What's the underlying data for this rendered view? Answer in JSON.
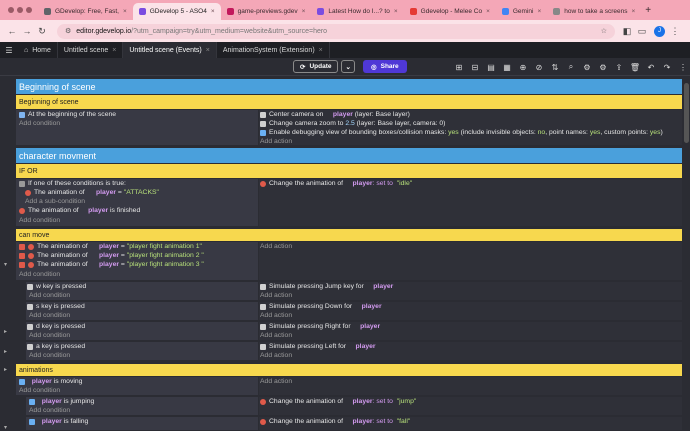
{
  "browser": {
    "tabs": [
      {
        "label": "GDevelop: Free, Fast,",
        "color": "#5f6368",
        "active": false
      },
      {
        "label": "GDevelop 5 - ASO4",
        "color": "#7b4ce0",
        "active": true
      },
      {
        "label": "game-previews.gdev",
        "color": "#c2185b",
        "active": false
      },
      {
        "label": "Latest How do I...? to",
        "color": "#7b4ce0",
        "active": false
      },
      {
        "label": "Gdevelop - Melee Co",
        "color": "#e53935",
        "active": false
      },
      {
        "label": "Gemini",
        "color": "#4285f4",
        "active": false
      },
      {
        "label": "how to take a screens",
        "color": "#888888",
        "active": false
      }
    ],
    "url_host": "editor.gdevelop.io",
    "url_path": "/?utm_campaign=try&utm_medium=website&utm_source=hero",
    "profile_initial": "J"
  },
  "app_tabs": [
    "Home",
    "Untitled scene",
    "Untitled scene (Events)",
    "AnimationSystem (Extension)"
  ],
  "toolbar": {
    "update_label": "Update",
    "share_label": "Share"
  },
  "events": {
    "g1": "Beginning of scene",
    "c1": "Beginning of scene",
    "e1_cond": "At the beginning of the scene",
    "add_condition": "Add condition",
    "add_action": "Add action",
    "add_subcondition": "Add a sub-condition",
    "e1_a1": {
      "pre": "Center camera on",
      "obj": "player",
      "post": "(layer: Base layer)"
    },
    "e1_a2": {
      "pre": "Change camera zoom to",
      "num": "2.5",
      "post": "(layer: Base layer, camera: 0)"
    },
    "e1_a3": {
      "text": "Enable debugging view of bounding boxes/collision masks:",
      "v1": "yes",
      "m1": "(include invisible objects:",
      "v2": "no",
      "m2": ", point names:",
      "v3": "yes",
      "m3": ", custom points:",
      "v4": "yes",
      "m4": ")"
    },
    "g2": "character movment",
    "c2": "IF OR",
    "e2_if": "If one of these conditions is true:",
    "e2_c1": {
      "pre": "The animation of",
      "obj": "player",
      "eq": "=",
      "str": "\"ATTACKS\""
    },
    "e2_c2": {
      "pre": "The animation of",
      "obj": "player",
      "post": "is finished"
    },
    "e2_a1": {
      "pre": "Change the animation of",
      "obj": "player",
      "mid": ": set to",
      "str": "\"idle\""
    },
    "c3": "can move",
    "e3_c1": {
      "pre": "The animation of",
      "obj": "player",
      "eq": "=",
      "str": "\"player fight animation 1\""
    },
    "e3_c2": {
      "pre": "The animation of",
      "obj": "player",
      "eq": "=",
      "str": "\"player fight animation 2 \""
    },
    "e3_c3": {
      "pre": "The animation of",
      "obj": "player",
      "eq": "=",
      "str": "\"player fight animation 3 \""
    },
    "keys": [
      {
        "key": "w",
        "cond": "key is pressed",
        "act": "Simulate pressing Jump key for",
        "obj": "player"
      },
      {
        "key": "s",
        "cond": "key is pressed",
        "act": "Simulate pressing Down for",
        "obj": "player"
      },
      {
        "key": "d",
        "cond": "key is pressed",
        "act": "Simulate pressing Right for",
        "obj": "player"
      },
      {
        "key": "a",
        "cond": "key is pressed",
        "act": "Simulate pressing Left for",
        "obj": "player"
      }
    ],
    "c4": "animations",
    "e4_cond": {
      "obj": "player",
      "post": "is moving"
    },
    "e5_cond": {
      "obj": "player",
      "post": "is jumping"
    },
    "e5_act": {
      "pre": "Change the animation of",
      "obj": "player",
      "mid": ": set to",
      "str": "\"jump\""
    },
    "e6_cond": {
      "obj": "player",
      "post": "is falling"
    },
    "e6_act": {
      "pre": "Change the animation of",
      "obj": "player",
      "mid": ": set to",
      "str": "\"fall\""
    }
  }
}
